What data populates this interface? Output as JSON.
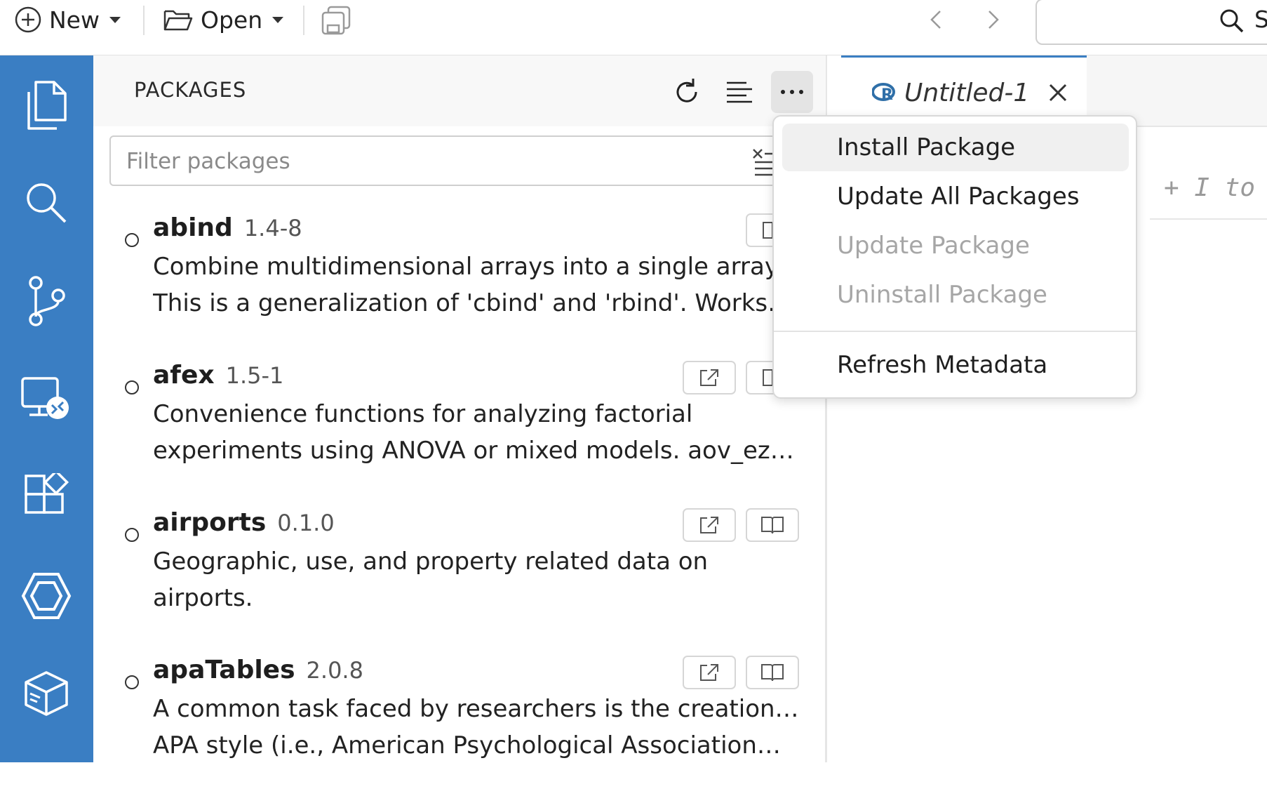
{
  "toolbar": {
    "new_label": "New",
    "open_label": "Open",
    "search_text": "S"
  },
  "panel": {
    "title": "PACKAGES",
    "filter_placeholder": "Filter packages"
  },
  "packages": [
    {
      "name": "abind",
      "version": "1.4-8",
      "desc1": "Combine multidimensional arrays into a single array.",
      "desc2": "This is a generalization of 'cbind' and 'rbind'. Works…"
    },
    {
      "name": "afex",
      "version": "1.5-1",
      "desc1": "Convenience functions for analyzing factorial",
      "desc2": "experiments using ANOVA or mixed models. aov_ez…"
    },
    {
      "name": "airports",
      "version": "0.1.0",
      "desc1": "Geographic, use, and property related data on",
      "desc2": "airports."
    },
    {
      "name": "apaTables",
      "version": "2.0.8",
      "desc1": "A common task faced by researchers is the creation of",
      "desc2": "APA style (i.e., American Psychological Association…"
    }
  ],
  "editor": {
    "tab_label": "Untitled-1",
    "hint_text": "+ I to g"
  },
  "menu": {
    "items": [
      {
        "label": "Install Package",
        "state": "hover"
      },
      {
        "label": "Update All Packages",
        "state": "enabled"
      },
      {
        "label": "Update Package",
        "state": "disabled"
      },
      {
        "label": "Uninstall Package",
        "state": "disabled"
      },
      {
        "label": "Refresh Metadata",
        "state": "enabled"
      }
    ]
  },
  "colors": {
    "activity_bar": "#3a7ec3",
    "r_logo": "#2f6fa8"
  }
}
